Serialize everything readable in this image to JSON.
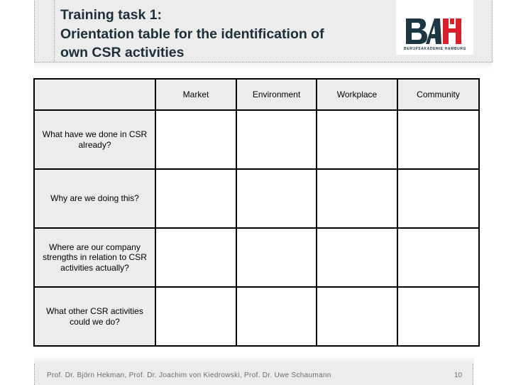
{
  "header": {
    "title_lines": [
      "Training task 1:",
      "Orientation table for the identification of",
      "own CSR activities"
    ],
    "logo": {
      "letters": [
        "B",
        "A",
        "H"
      ],
      "subtitle": "BERUFSAKADEMIE HAMBURG",
      "colors": {
        "dark": "#1c3742",
        "red": "#d8202c"
      }
    }
  },
  "table": {
    "corner": "",
    "columns": [
      "Market",
      "Environment",
      "Workplace",
      "Community"
    ],
    "rows": [
      {
        "question": "What have we done in CSR already?",
        "cells": [
          "",
          "",
          "",
          ""
        ]
      },
      {
        "question": "Why are we doing this?",
        "cells": [
          "",
          "",
          "",
          ""
        ]
      },
      {
        "question": "Where are our company strengths in relation to CSR activities actually?",
        "cells": [
          "",
          "",
          "",
          ""
        ]
      },
      {
        "question": "What other CSR activities could we do?",
        "cells": [
          "",
          "",
          "",
          ""
        ]
      }
    ]
  },
  "footer": {
    "authors": "Prof. Dr. Björn Hekman, Prof. Dr. Joachim von Kiedrowski, Prof. Dr. Uwe Schaumann",
    "page_number": "10"
  }
}
